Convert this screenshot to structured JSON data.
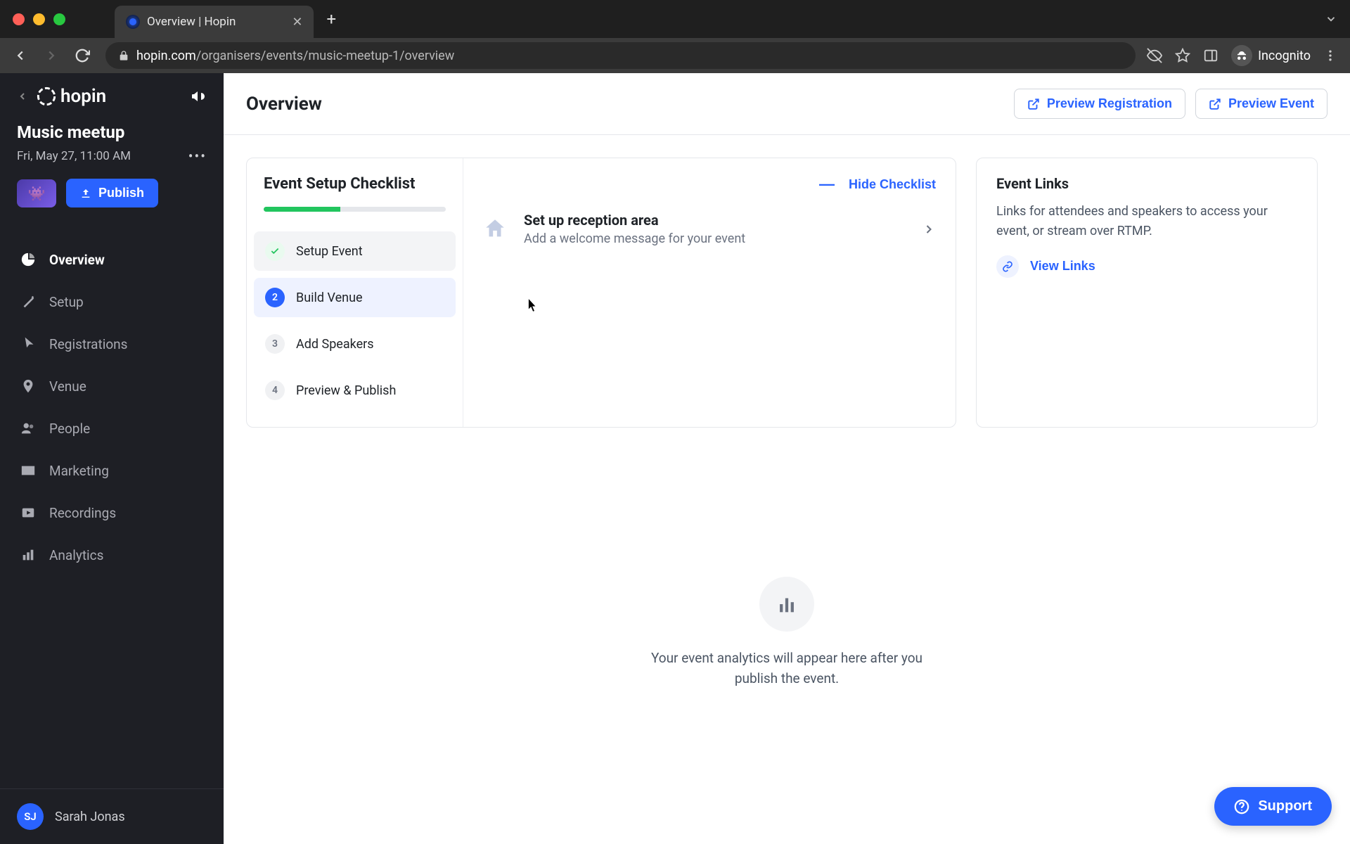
{
  "browser": {
    "tab_title": "Overview | Hopin",
    "url_host": "hopin.com",
    "url_path": "/organisers/events/music-meetup-1/overview",
    "incognito_label": "Incognito"
  },
  "sidebar": {
    "brand": "hopin",
    "event_title": "Music meetup",
    "event_date": "Fri, May 27, 11:00 AM",
    "publish_label": "Publish",
    "nav": [
      {
        "label": "Overview",
        "icon": "pie"
      },
      {
        "label": "Setup",
        "icon": "wand"
      },
      {
        "label": "Registrations",
        "icon": "ticket"
      },
      {
        "label": "Venue",
        "icon": "pin"
      },
      {
        "label": "People",
        "icon": "people"
      },
      {
        "label": "Marketing",
        "icon": "mail"
      },
      {
        "label": "Recordings",
        "icon": "video"
      },
      {
        "label": "Analytics",
        "icon": "bars"
      }
    ],
    "user_initials": "SJ",
    "user_name": "Sarah Jonas"
  },
  "header": {
    "title": "Overview",
    "preview_registration": "Preview Registration",
    "preview_event": "Preview Event"
  },
  "checklist": {
    "title": "Event Setup Checklist",
    "progress_percent": 42,
    "hide_label": "Hide Checklist",
    "steps": [
      {
        "label": "Setup Event",
        "state": "done"
      },
      {
        "label": "Build Venue",
        "state": "active",
        "num": "2"
      },
      {
        "label": "Add Speakers",
        "state": "pending",
        "num": "3"
      },
      {
        "label": "Preview & Publish",
        "state": "pending",
        "num": "4"
      }
    ],
    "task": {
      "title": "Set up reception area",
      "desc": "Add a welcome message for your event"
    }
  },
  "links_card": {
    "title": "Event Links",
    "desc": "Links for attendees and speakers to access your event, or stream over RTMP.",
    "view_label": "View Links"
  },
  "analytics_empty": "Your event analytics will appear here after you publish the event.",
  "support_label": "Support"
}
